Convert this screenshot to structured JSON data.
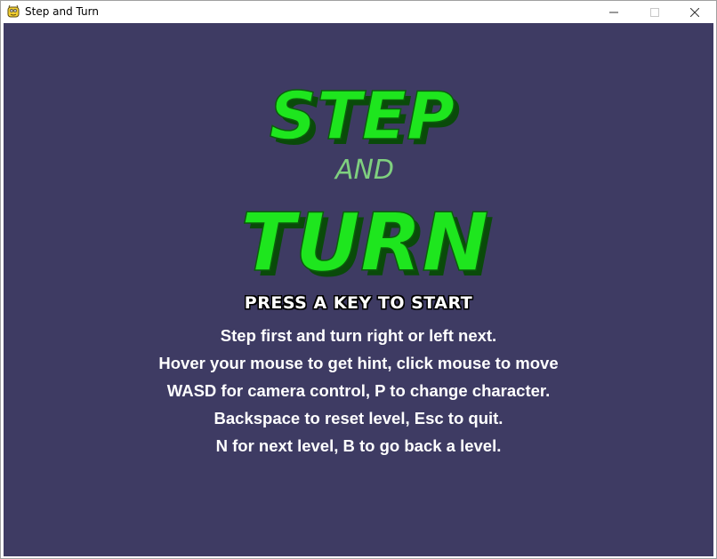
{
  "window": {
    "title": "Step and Turn",
    "app_icon": "pygame-snake-icon",
    "controls": [
      "minimize-icon",
      "maximize-icon",
      "close-icon"
    ]
  },
  "game": {
    "background_color": "#3e3b63",
    "logo": {
      "line1": "STEP",
      "line2": "AND",
      "line3": "TURN",
      "fill_color": "#1ee61e",
      "shadow_color": "#0a4a0a",
      "and_color": "#7fd07f"
    },
    "press_key": "PRESS A KEY TO START",
    "instructions": [
      "Step first and turn right or left next.",
      "Hover your mouse to get hint, click mouse to move",
      "WASD for camera control, P to change character.",
      "Backspace to reset level, Esc to quit.",
      "N for next level, B to go back a level."
    ]
  }
}
